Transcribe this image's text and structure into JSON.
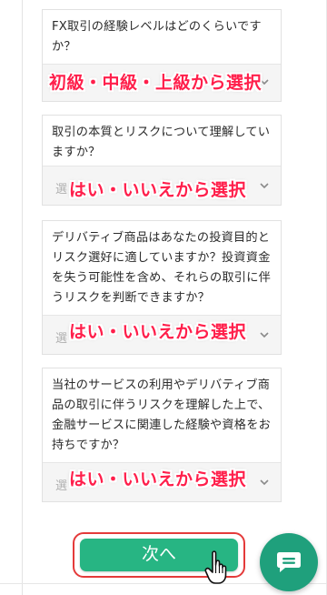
{
  "questions": [
    {
      "text": "FX取引の経験レベルはどのくらいですか？",
      "callout": "初級・中級・上級から選択"
    },
    {
      "text": "取引の本質とリスクについて理解していますか？",
      "placeholder": "選",
      "callout": "はい・いいえから選択"
    },
    {
      "text": "デリバティブ商品はあなたの投資目的とリスク選好に適していますか？投資資金を失う可能性を含め、それらの取引に伴うリスクを判断できますか？",
      "placeholder": "選",
      "callout": "はい・いいえから選択"
    },
    {
      "text": "当社のサービスの利用やデリバティブ商品の取引に伴うリスクを理解した上で、金融サービスに関連した経験や資格をお持ちですか？",
      "placeholder": "選",
      "callout": "はい・いいえから選択"
    }
  ],
  "next_button": {
    "label": "次へ"
  },
  "colors": {
    "accent_green": "#27b583",
    "callout_red": "#ff1f4b",
    "highlight_border": "#e43a3a"
  },
  "icons": {
    "dropdown": "chevron-down-icon",
    "cursor": "hand-pointer-icon",
    "chat": "chat-icon"
  }
}
